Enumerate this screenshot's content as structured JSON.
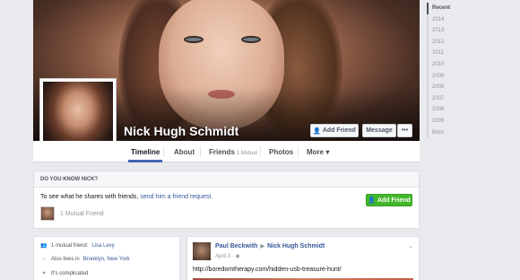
{
  "profile": {
    "name": "Nick Hugh Schmidt"
  },
  "actions": {
    "add_friend": "Add Friend",
    "message": "Message",
    "more": "•••"
  },
  "tabs": {
    "timeline": "Timeline",
    "about": "About",
    "friends": "Friends",
    "friends_count": "1 Mutual",
    "photos": "Photos",
    "more": "More ▾"
  },
  "know_box": {
    "header": "DO YOU KNOW NICK?",
    "text_prefix": "To see what he shares with friends,",
    "link": "send him a friend request.",
    "button": "Add Friend",
    "mutual": "1 Mutual Friend"
  },
  "intro": {
    "mutual_prefix": "1 mutual friend:",
    "mutual_name": "Lisa Levy",
    "lives_prefix": "Also lives in",
    "lives_place": "Brooklyn, New York",
    "relationship": "It's complicated"
  },
  "post": {
    "author": "Paul Beckwith",
    "target": "Nick Hugh Schmidt",
    "date": "April 3 ·",
    "link": "http://boredomtherapy.com/hidden-usb-treasure-hunt/"
  },
  "years": [
    "Recent",
    "2014",
    "2013",
    "2012",
    "2011",
    "2010",
    "2009",
    "2008",
    "2007",
    "2006",
    "2005",
    "Born"
  ],
  "colors": {
    "fb_blue": "#4267b2",
    "link_blue": "#365899",
    "green": "#42b72a",
    "background": "#e9eaed"
  }
}
